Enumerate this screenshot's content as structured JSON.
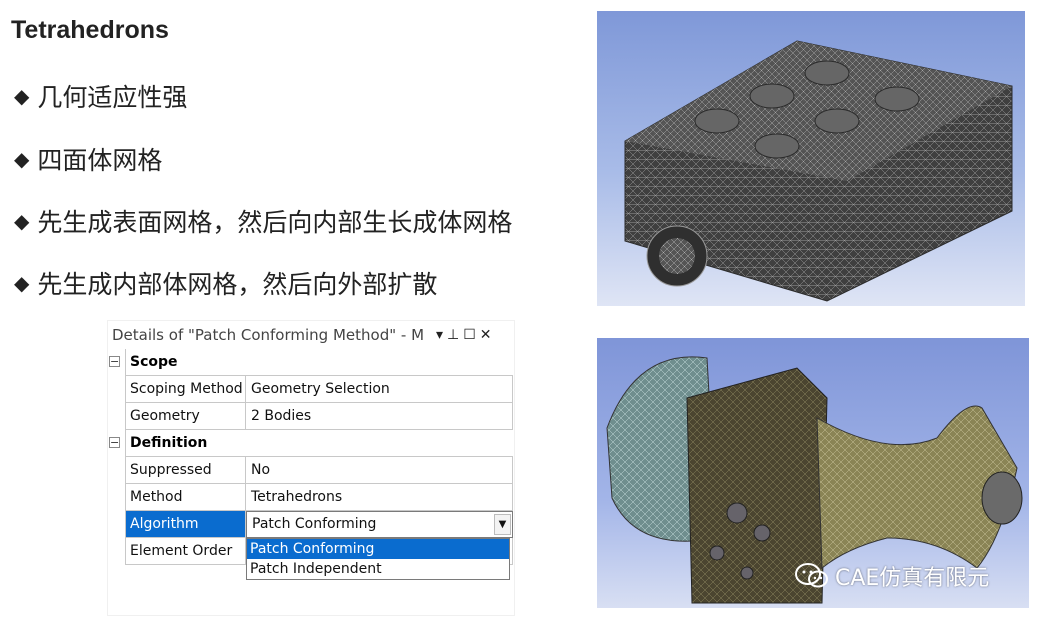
{
  "slide": {
    "title": "Tetrahedrons",
    "bullets": [
      "几何适应性强",
      "四面体网格",
      "先生成表面网格，然后向内部生长成体网格",
      "先生成内部体网格，然后向外部扩散"
    ],
    "bullet_symbol": "◆"
  },
  "panel": {
    "title": "Details of \"Patch Conforming Method\" - M",
    "header_buttons": {
      "dropdown": "▾",
      "pin": "⊥",
      "maximize": "☐",
      "close": "✕"
    },
    "groups": [
      {
        "label": "Scope",
        "expander": "−",
        "rows": [
          {
            "prop": "Scoping Method",
            "value": "Geometry Selection"
          },
          {
            "prop": "Geometry",
            "value": "2 Bodies"
          }
        ]
      },
      {
        "label": "Definition",
        "expander": "−",
        "rows": [
          {
            "prop": "Suppressed",
            "value": "No"
          },
          {
            "prop": "Method",
            "value": "Tetrahedrons"
          },
          {
            "prop": "Algorithm",
            "value": "Patch Conforming"
          },
          {
            "prop": "Element Order",
            "value": ""
          }
        ]
      }
    ],
    "dropdown_options": [
      "Patch Conforming",
      "Patch Independent"
    ],
    "dropdown_highlighted": "Patch Conforming",
    "select_arrow": "▼"
  },
  "watermark": {
    "text": "CAE仿真有限元",
    "icon": "wechat-icon"
  },
  "colors": {
    "selection": "#0a6ccf",
    "sky_top": "#7f98d8",
    "mesh": "#4a4a4a"
  }
}
